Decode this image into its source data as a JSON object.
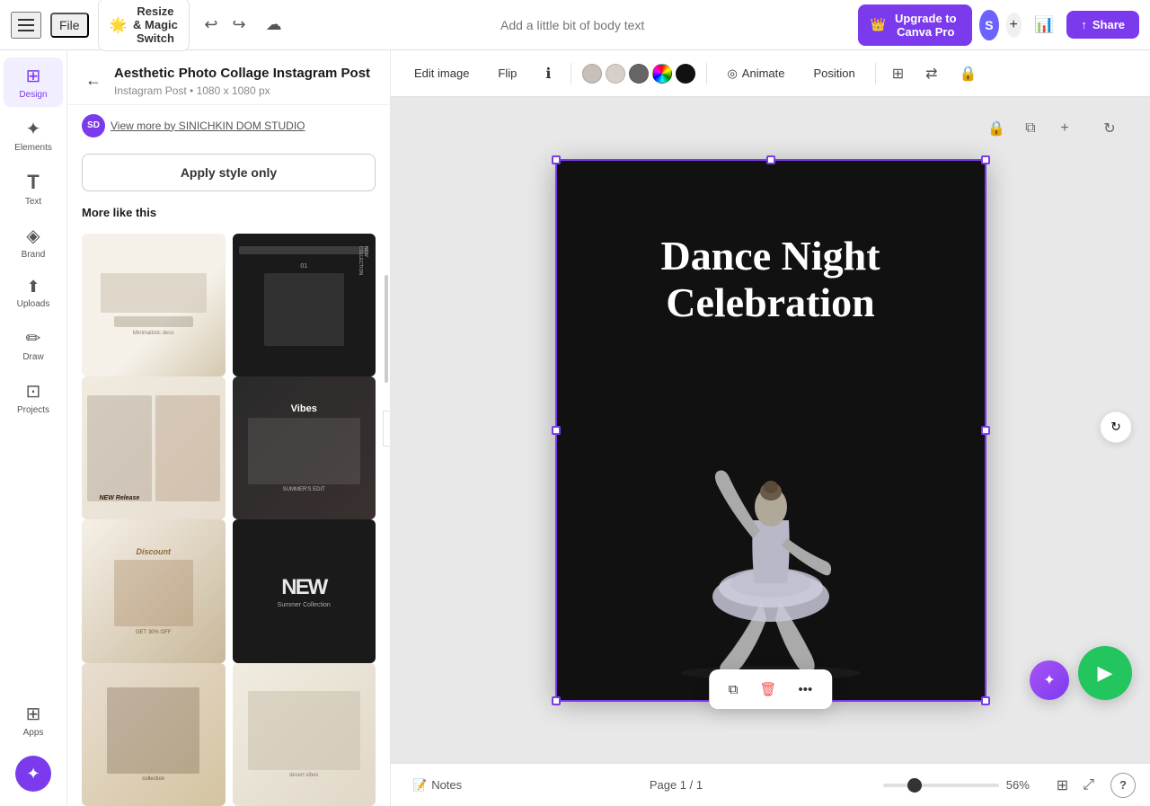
{
  "topbar": {
    "file_label": "File",
    "magic_switch_label": "Resize & Magic Switch",
    "doc_title_placeholder": "Add a little bit of body text",
    "upgrade_label": "Upgrade to Canva Pro",
    "share_label": "Share",
    "avatar_initials": "S"
  },
  "toolbar": {
    "edit_image": "Edit image",
    "flip": "Flip",
    "animate": "Animate",
    "position": "Position",
    "colors": {
      "swatch1": "#c8c0b8",
      "swatch2": "#d8d0c8",
      "swatch3": "#666",
      "swatch4": "#7c3aed",
      "swatch5": "#111"
    }
  },
  "left_panel": {
    "template_title": "Aesthetic Photo Collage Instagram Post",
    "template_subtitle": "Instagram Post • 1080 x 1080 px",
    "author_initials": "SD",
    "author_text": "View more by SINICHKIN DOM STUDIO",
    "apply_style_label": "Apply style only",
    "more_like_this": "More like this"
  },
  "nav": {
    "items": [
      {
        "label": "Design",
        "icon": "⊞",
        "active": true
      },
      {
        "label": "Elements",
        "icon": "✦"
      },
      {
        "label": "Text",
        "icon": "T"
      },
      {
        "label": "Brand",
        "icon": "◈"
      },
      {
        "label": "Uploads",
        "icon": "↑"
      },
      {
        "label": "Draw",
        "icon": "✏"
      },
      {
        "label": "Projects",
        "icon": "⊡"
      },
      {
        "label": "Apps",
        "icon": "⊞"
      }
    ]
  },
  "canvas": {
    "text_line1": "Dance Night",
    "text_line2": "Celebration",
    "page_info": "Page 1 / 1",
    "zoom_level": "56%"
  },
  "bottom_bar": {
    "notes_label": "Notes",
    "page_label": "Page 1 / 1",
    "zoom": "56%"
  },
  "floating_toolbar": {
    "copy_icon": "⧉",
    "delete_icon": "🗑",
    "more_icon": "•••"
  }
}
